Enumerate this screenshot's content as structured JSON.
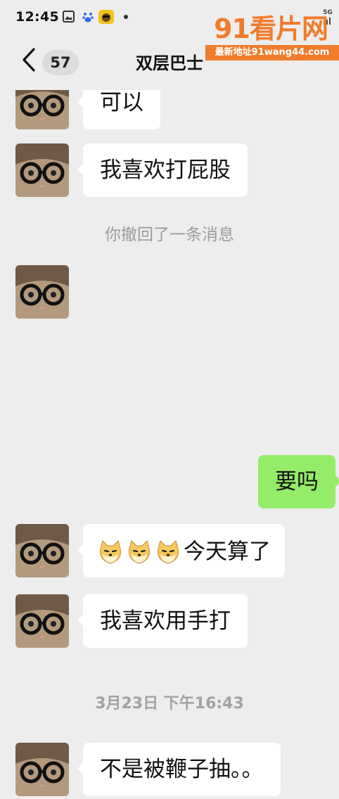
{
  "status_bar": {
    "time": "12:45",
    "network_label": "5G",
    "icons": [
      "gallery-icon",
      "baidu-icon",
      "app-icon",
      "notification-dot-icon",
      "signal-icon"
    ]
  },
  "watermark": {
    "logo_text": "91看片网",
    "url_text": "最新地址91wang44.com"
  },
  "nav": {
    "back_icon": "chevron-left-icon",
    "unread_count": "57",
    "title": "双层巴士"
  },
  "messages": [
    {
      "side": "left",
      "text": "可以"
    },
    {
      "side": "left",
      "text": "我喜欢打屁股"
    },
    {
      "system": "你撤回了一条消息"
    },
    {
      "side": "left",
      "image": "avatar-only"
    },
    {
      "side": "right",
      "text": "要吗"
    },
    {
      "side": "left",
      "emojis": [
        "doge-emoji",
        "doge-emoji",
        "doge-emoji"
      ],
      "text": "今天算了"
    },
    {
      "side": "left",
      "text": "我喜欢用手打"
    },
    {
      "timestamp": "3月23日 下午16:43"
    },
    {
      "side": "left",
      "text": "不是被鞭子抽。。"
    }
  ],
  "colors": {
    "background": "#ededed",
    "bubble_left": "#ffffff",
    "bubble_right": "#95ec69",
    "system_text": "#9b9b9b",
    "watermark": "#f07c2c"
  }
}
